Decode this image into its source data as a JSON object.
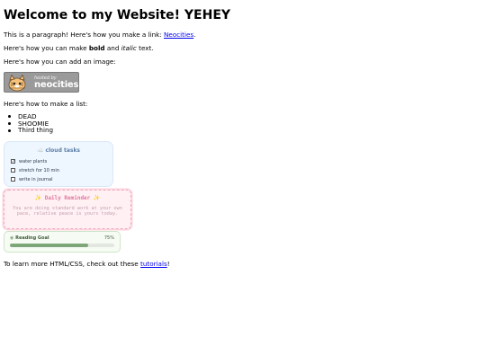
{
  "page": {
    "title": "Welcome to my Website! YEHEY",
    "p1_text": "This is a paragraph! Here's how you make a link: ",
    "p1_link": "Neocities",
    "p1_end": ".",
    "p2_a": "Here's how you can make ",
    "p2_bold": "bold",
    "p2_b": " and ",
    "p2_italic": "italic",
    "p2_c": " text.",
    "p3_text": "Here's how you can add an image:",
    "badge": {
      "small": "hosted by",
      "big": "neocities"
    },
    "p4_text": "Here's how to make a list:",
    "list": [
      "DEAD",
      "SHOOMIE",
      "Third thing"
    ],
    "footer_text": "To learn more HTML/CSS, check out these ",
    "footer_link": "tutorials",
    "footer_end": "!"
  },
  "tasks_card": {
    "title": "☁️ cloud tasks",
    "items": [
      {
        "label": "water plants",
        "checked": true
      },
      {
        "label": "stretch for 10 min",
        "checked": false
      },
      {
        "label": "write in journal",
        "checked": false
      }
    ]
  },
  "reminder_card": {
    "title": "✨ Daily Reminder ✨",
    "body": "You are doing standard work at your own pace, relative peace is yours today."
  },
  "goal_card": {
    "label": "Reading Goal",
    "percent_text": "75%",
    "progress": 0.75
  },
  "colors": {
    "link": "#0000ee",
    "tasks_bg": "#eef6ff",
    "reminder_bg": "#fff0f4",
    "goal_fill": "#7ea678"
  }
}
